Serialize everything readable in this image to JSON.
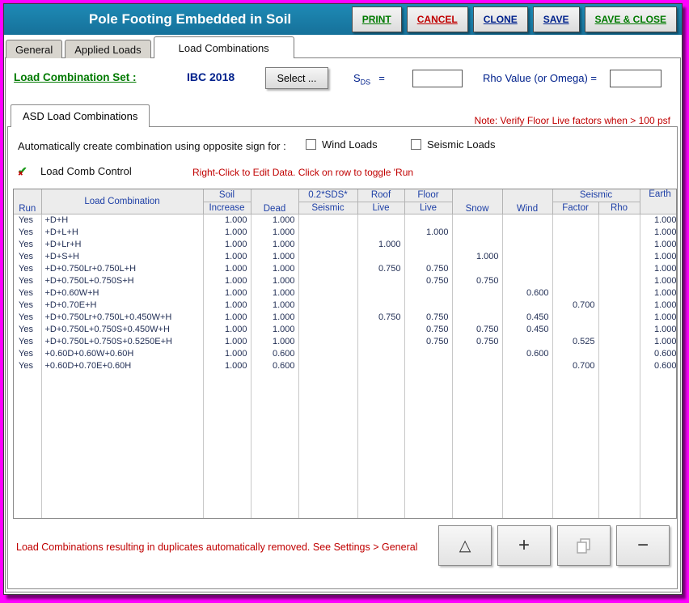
{
  "colors": {
    "titlebar": "#1B7FA9",
    "accent_green": "#007A00",
    "accent_red": "#C00000",
    "navy": "#00218C",
    "frame_magenta": "#FF00FF"
  },
  "window": {
    "title": "Pole Footing Embedded in Soil",
    "help_icon": "?",
    "buttons": [
      {
        "label": "PRINT",
        "color": "#007A00"
      },
      {
        "label": "CANCEL",
        "color": "#C00000"
      },
      {
        "label": "CLONE",
        "color": "#00218C"
      },
      {
        "label": "SAVE",
        "color": "#00218C"
      },
      {
        "label": "SAVE & CLOSE",
        "color": "#007A00"
      }
    ]
  },
  "tabs": [
    {
      "label": "General",
      "active": false
    },
    {
      "label": "Applied Loads",
      "active": false
    },
    {
      "label": "Load Combinations",
      "active": true
    }
  ],
  "combo_set": {
    "label": "Load Combination Set :",
    "value": "IBC 2018",
    "select_button": "Select ...",
    "sds_label": "S",
    "sds_sub": "DS",
    "sds_eq": "=",
    "sds_value": "",
    "rho_label": "Rho Value (or Omega)  =",
    "rho_value": ""
  },
  "asd_panel": {
    "tab_label": "ASD Load Combinations",
    "top_note": "Note: Verify Floor Live factors when > 100 psf",
    "auto_label": "Automatically create combination using opposite sign for :",
    "checkboxes": [
      {
        "label": "Wind Loads",
        "checked": false
      },
      {
        "label": "Seismic Loads",
        "checked": false
      }
    ],
    "control_label": "Load Comb Control",
    "control_hint": "Right-Click to Edit Data. Click on row to toggle 'Run"
  },
  "table": {
    "h_run": "Run",
    "h_combo": "Load Combination",
    "h_soil": "Soil",
    "h_soil2": "Increase",
    "h_dead": "Dead",
    "h_sds": "0.2*SDS*",
    "h_sds2": "Seismic",
    "h_roof": "Roof",
    "h_roof2": "Live",
    "h_floor": "Floor",
    "h_floor2": "Live",
    "h_snow": "Snow",
    "h_wind": "Wind",
    "h_seismic": "Seismic",
    "h_factor": "Factor",
    "h_rho": "Rho",
    "h_earth": "Earth",
    "rows": [
      [
        "Yes",
        "+D+H",
        "1.000",
        "1.000",
        "",
        "",
        "",
        "",
        "",
        "",
        "",
        "1.000"
      ],
      [
        "Yes",
        "+D+L+H",
        "1.000",
        "1.000",
        "",
        "",
        "1.000",
        "",
        "",
        "",
        "",
        "1.000"
      ],
      [
        "Yes",
        "+D+Lr+H",
        "1.000",
        "1.000",
        "",
        "1.000",
        "",
        "",
        "",
        "",
        "",
        "1.000"
      ],
      [
        "Yes",
        "+D+S+H",
        "1.000",
        "1.000",
        "",
        "",
        "",
        "1.000",
        "",
        "",
        "",
        "1.000"
      ],
      [
        "Yes",
        "+D+0.750Lr+0.750L+H",
        "1.000",
        "1.000",
        "",
        "0.750",
        "0.750",
        "",
        "",
        "",
        "",
        "1.000"
      ],
      [
        "Yes",
        "+D+0.750L+0.750S+H",
        "1.000",
        "1.000",
        "",
        "",
        "0.750",
        "0.750",
        "",
        "",
        "",
        "1.000"
      ],
      [
        "Yes",
        "+D+0.60W+H",
        "1.000",
        "1.000",
        "",
        "",
        "",
        "",
        "0.600",
        "",
        "",
        "1.000"
      ],
      [
        "Yes",
        "+D+0.70E+H",
        "1.000",
        "1.000",
        "",
        "",
        "",
        "",
        "",
        "0.700",
        "",
        "1.000"
      ],
      [
        "Yes",
        "+D+0.750Lr+0.750L+0.450W+H",
        "1.000",
        "1.000",
        "",
        "0.750",
        "0.750",
        "",
        "0.450",
        "",
        "",
        "1.000"
      ],
      [
        "Yes",
        "+D+0.750L+0.750S+0.450W+H",
        "1.000",
        "1.000",
        "",
        "",
        "0.750",
        "0.750",
        "0.450",
        "",
        "",
        "1.000"
      ],
      [
        "Yes",
        "+D+0.750L+0.750S+0.5250E+H",
        "1.000",
        "1.000",
        "",
        "",
        "0.750",
        "0.750",
        "",
        "0.525",
        "",
        "1.000"
      ],
      [
        "Yes",
        "+0.60D+0.60W+0.60H",
        "1.000",
        "0.600",
        "",
        "",
        "",
        "",
        "0.600",
        "",
        "",
        "0.600"
      ],
      [
        "Yes",
        "+0.60D+0.70E+0.60H",
        "1.000",
        "0.600",
        "",
        "",
        "",
        "",
        "",
        "0.700",
        "",
        "0.600"
      ]
    ]
  },
  "footer": {
    "note": "Load Combinations resulting in duplicates automatically removed. See Settings > General",
    "buttons": [
      {
        "name": "expand",
        "glyph": "△"
      },
      {
        "name": "add",
        "glyph": "+"
      },
      {
        "name": "copy",
        "glyph": ""
      },
      {
        "name": "remove",
        "glyph": "−"
      }
    ]
  }
}
